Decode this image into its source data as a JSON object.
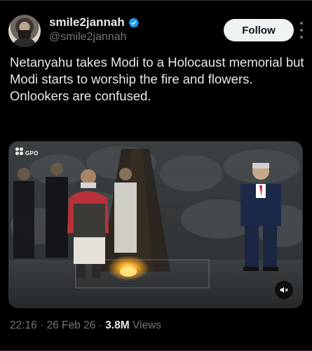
{
  "author": {
    "display_name": "smile2jannah",
    "handle": "@smile2jannah",
    "verified": true,
    "verified_color": "#1d9bf0"
  },
  "follow_label": "Follow",
  "tweet": {
    "lines": [
      "Netanyahu takes Modi to a Holocaust memorial but Modi starts to worship the fire and flowers.",
      "Onlookers are confused."
    ]
  },
  "media": {
    "watermark": "GPO",
    "icon": "volume-muted-icon"
  },
  "meta": {
    "time": "22:16",
    "separator_1": " · ",
    "date": "26 Feb 26",
    "separator_2": " · ",
    "views_count": "3.8M",
    "views_label": " Views"
  },
  "colors": {
    "background": "#000000",
    "text": "#e7e9ea",
    "secondary": "#71767b",
    "follow_bg": "#eff3f4"
  }
}
